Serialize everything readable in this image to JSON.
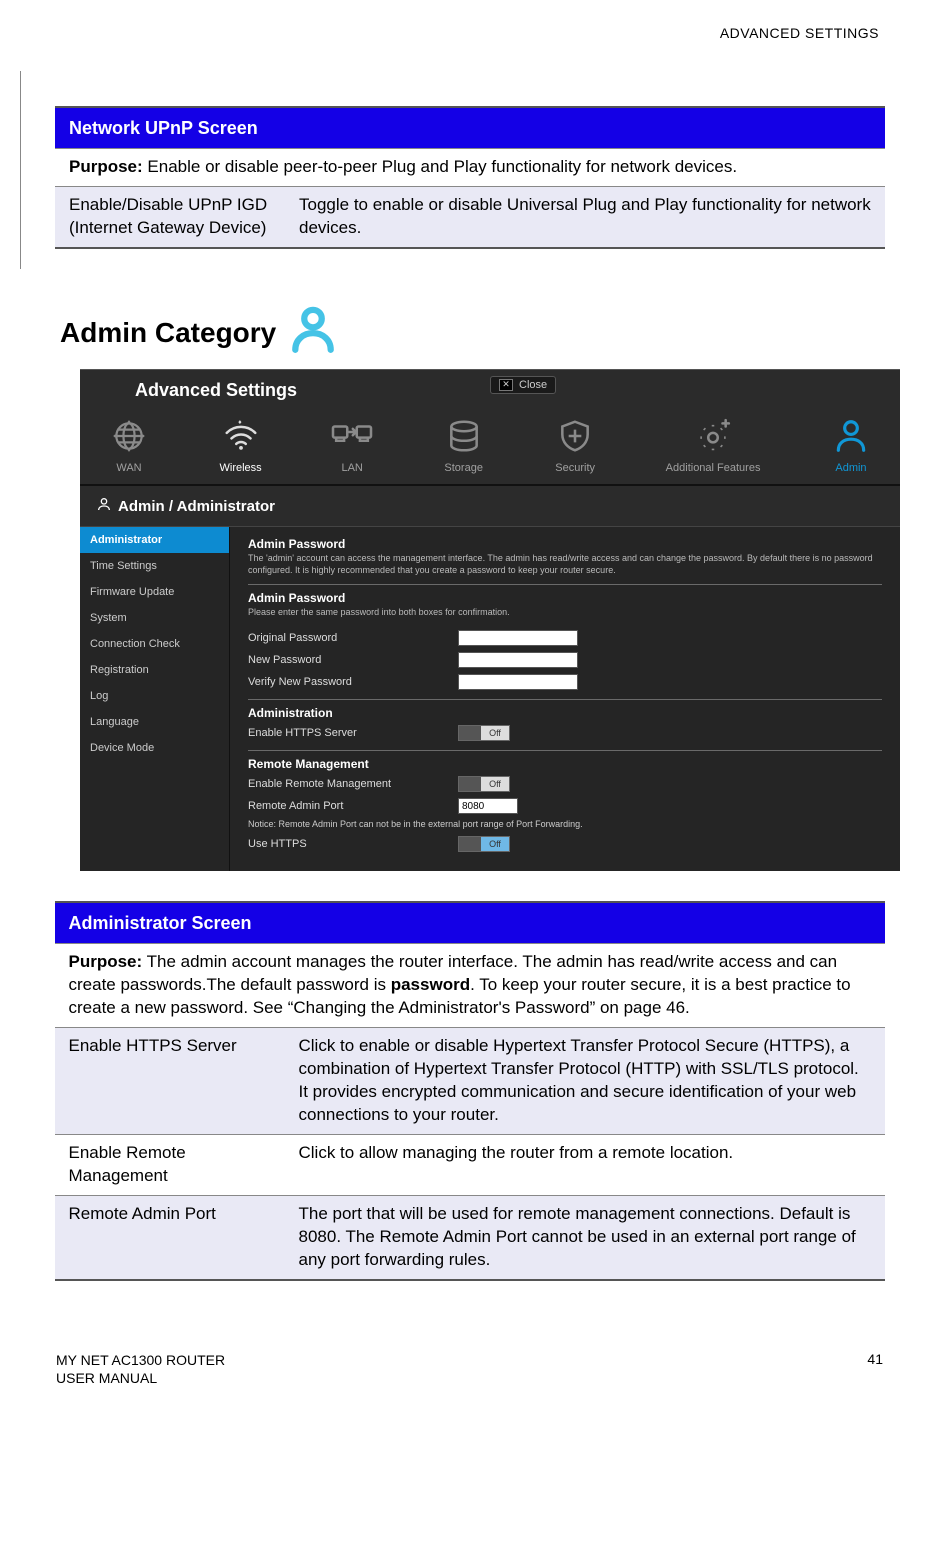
{
  "header": {
    "running": "ADVANCED SETTINGS"
  },
  "upnp_table": {
    "title": "Network UPnP Screen",
    "purpose_label": "Purpose:",
    "purpose_text": " Enable or disable peer-to-peer Plug and Play functionality for network devices.",
    "row_label": "Enable/Disable UPnP IGD (Internet Gateway Device)",
    "row_desc": "Toggle to enable or disable Universal Plug and Play functionality for network devices."
  },
  "heading": "Admin Category",
  "screenshot": {
    "title": "Advanced Settings",
    "close": "Close",
    "topnav": {
      "wan": "WAN",
      "wireless": "Wireless",
      "lan": "LAN",
      "storage": "Storage",
      "security": "Security",
      "additional": "Additional Features",
      "admin": "Admin"
    },
    "crumb": "Admin / Administrator",
    "sidemenu": {
      "administrator": "Administrator",
      "time": "Time Settings",
      "firmware": "Firmware Update",
      "system": "System",
      "conn": "Connection Check",
      "reg": "Registration",
      "log": "Log",
      "lang": "Language",
      "device": "Device Mode"
    },
    "sections": {
      "s1_title": "Admin Password",
      "s1_desc": "The 'admin' account can access the management interface. The admin has read/write access and can change the password. By default there is no password configured. It is highly recommended that you create a password to keep your router secure.",
      "s2_title": "Admin Password",
      "s2_desc": "Please enter the same password into both boxes for confirmation.",
      "orig_pw": "Original Password",
      "new_pw": "New Password",
      "verify_pw": "Verify New Password",
      "s3_title": "Administration",
      "https": "Enable HTTPS Server",
      "s4_title": "Remote Management",
      "remote": "Enable Remote Management",
      "port_label": "Remote Admin Port",
      "port_value": "8080",
      "notice": "Notice: Remote Admin Port can not be in the external port range of Port Forwarding.",
      "use_https": "Use HTTPS",
      "off": "Off"
    }
  },
  "admin_table": {
    "title": "Administrator Screen",
    "purpose_label": "Purpose:",
    "purpose_1": " The admin account manages the router interface. The admin has read/write access and can create passwords.The default password is ",
    "purpose_bold": "password",
    "purpose_2": ". To keep your router secure, it is a best practice to create a new password. See “Changing the Administrator's Password” on page 46.",
    "r1_label": "Enable HTTPS Server",
    "r1_desc": "Click to enable or disable Hypertext Transfer Protocol Secure (HTTPS), a combination of Hypertext Transfer Protocol (HTTP) with SSL/TLS protocol. It provides encrypted communication and secure identification of your web connections to your router.",
    "r2_label": "Enable Remote Management",
    "r2_desc": "Click to allow managing the router from a remote location.",
    "r3_label": "Remote Admin Port",
    "r3_desc": "The port that will be used for remote management connections. Default is 8080. The Remote Admin Port cannot be used in an external port range of any port forwarding rules."
  },
  "footer": {
    "line1": "MY NET AC1300 ROUTER",
    "line2": "USER MANUAL",
    "page": "41"
  }
}
